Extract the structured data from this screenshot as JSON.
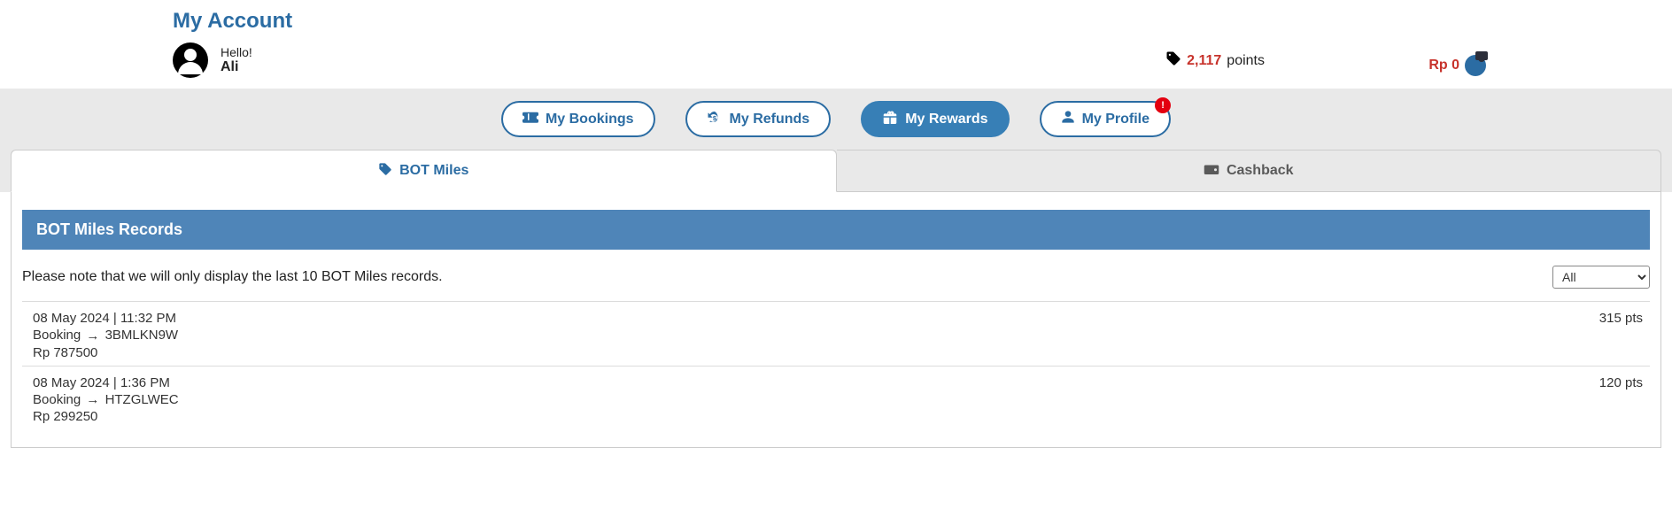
{
  "header": {
    "page_title": "My Account",
    "hello": "Hello!",
    "username": "Ali",
    "points_value": "2,117",
    "points_unit": "points",
    "wallet_amount": "Rp 0"
  },
  "nav": {
    "bookings": "My Bookings",
    "refunds": "My Refunds",
    "rewards": "My Rewards",
    "profile": "My Profile",
    "profile_notif": "!"
  },
  "tabs": {
    "miles": "BOT Miles",
    "cashback": "Cashback"
  },
  "miles_panel": {
    "banner": "BOT Miles Records",
    "note": "Please note that we will only display the last 10 BOT Miles records.",
    "filter_selected": "All",
    "filter_options": [
      "All"
    ],
    "records": [
      {
        "timestamp": "08 May 2024 | 11:32 PM",
        "type": "Booking",
        "ref": "3BMLKN9W",
        "amount": "Rp 787500",
        "points": "315 pts"
      },
      {
        "timestamp": "08 May 2024 | 1:36 PM",
        "type": "Booking",
        "ref": "HTZGLWEC",
        "amount": "Rp 299250",
        "points": "120 pts"
      }
    ]
  }
}
